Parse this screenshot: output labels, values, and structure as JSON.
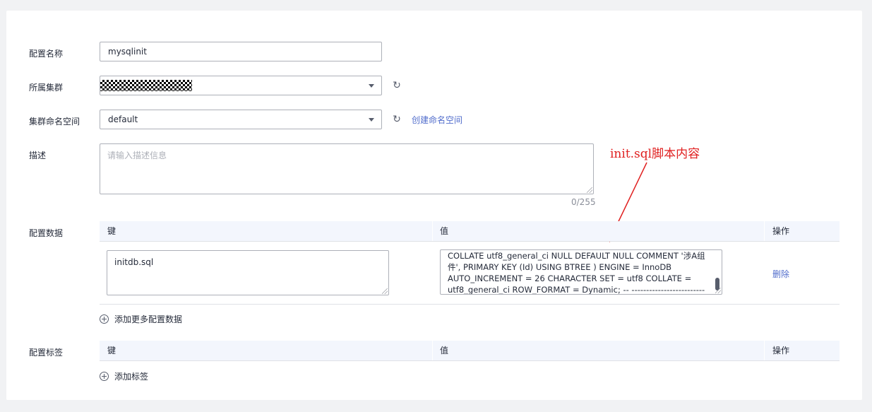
{
  "form": {
    "config_name": {
      "label": "配置名称",
      "value": "mysqlinit"
    },
    "cluster": {
      "label": "所属集群",
      "value": ""
    },
    "namespace": {
      "label": "集群命名空间",
      "value": "default",
      "create_link": "创建命名空间"
    },
    "description": {
      "label": "描述",
      "placeholder": "请输入描述信息",
      "counter": "0/255"
    },
    "config_data": {
      "label": "配置数据",
      "columns": [
        "键",
        "值",
        "操作"
      ],
      "rows": [
        {
          "key": "initdb.sql",
          "value": "COLLATE utf8_general_ci NULL DEFAULT NULL COMMENT '涉A组件', PRIMARY KEY (Id) USING BTREE ) ENGINE = InnoDB AUTO_INCREMENT = 26 CHARACTER SET = utf8 COLLATE = utf8_general_ci ROW_FORMAT = Dynamic; -- -------------------------",
          "action": "删除"
        }
      ],
      "add_label": "添加更多配置数据"
    },
    "config_tags": {
      "label": "配置标签",
      "columns": [
        "键",
        "值",
        "操作"
      ],
      "add_label": "添加标签"
    }
  },
  "annotation": {
    "text": "init.sql脚本内容",
    "color": "#e02020"
  },
  "colors": {
    "link": "#526ecc",
    "table_header": "#f3f6fd",
    "border": "#adb0b8"
  },
  "icons": [
    "refresh-icon",
    "chevron-down-icon",
    "add-circle-icon",
    "resize-handle-icon"
  ]
}
